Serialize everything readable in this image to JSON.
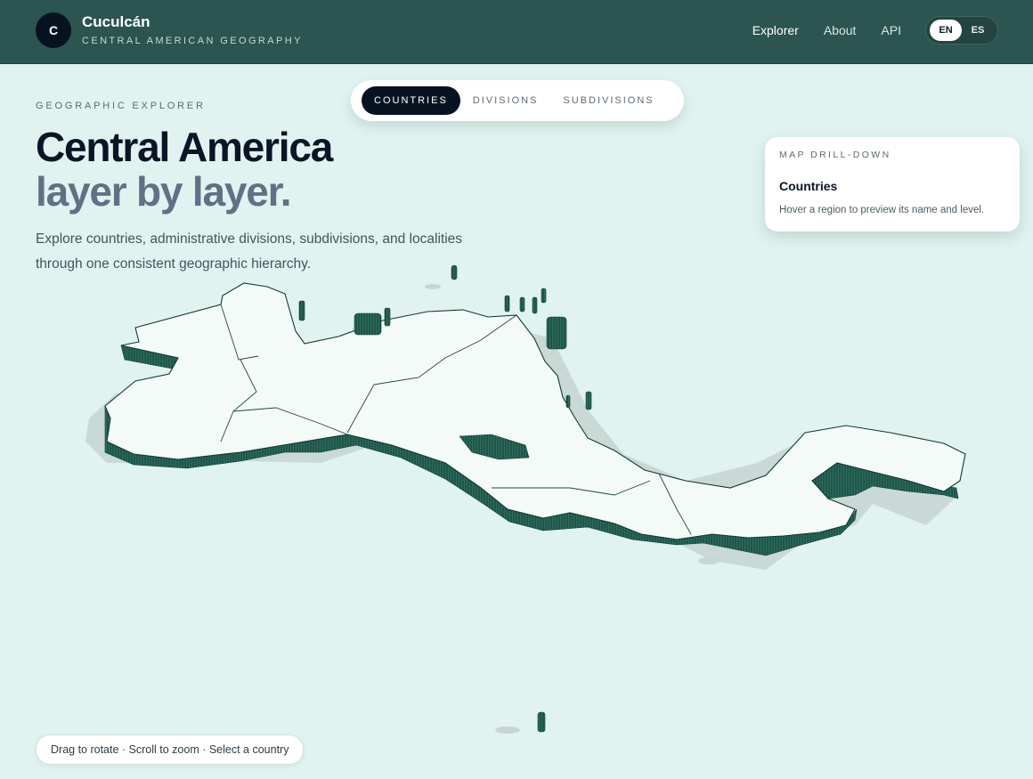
{
  "header": {
    "logo_letter": "C",
    "brand_name": "Cuculcán",
    "brand_subtitle": "CENTRAL AMERICAN GEOGRAPHY",
    "nav": [
      "Explorer",
      "About",
      "API"
    ],
    "lang": [
      "EN",
      "ES"
    ],
    "active_lang": "EN"
  },
  "hero": {
    "eyebrow": "GEOGRAPHIC EXPLORER",
    "title_line1": "Central America",
    "title_line2": "layer by layer.",
    "lead": "Explore countries, administrative divisions, subdivisions, and localities through one consistent geographic hierarchy."
  },
  "levels": {
    "tabs": [
      "COUNTRIES",
      "DIVISIONS",
      "SUBDIVISIONS"
    ],
    "active": "COUNTRIES"
  },
  "drill_card": {
    "eyebrow": "MAP DRILL-DOWN",
    "title": "Countries",
    "description": "Hover a region to preview its name and level."
  },
  "hint": "Drag to rotate · Scroll to zoom · Select a country",
  "colors": {
    "header_bg": "#2c5450",
    "page_bg": "#e0f3f0",
    "land": "#f3faf8",
    "extrusion": "#1d5a4c",
    "ink": "#081321"
  }
}
